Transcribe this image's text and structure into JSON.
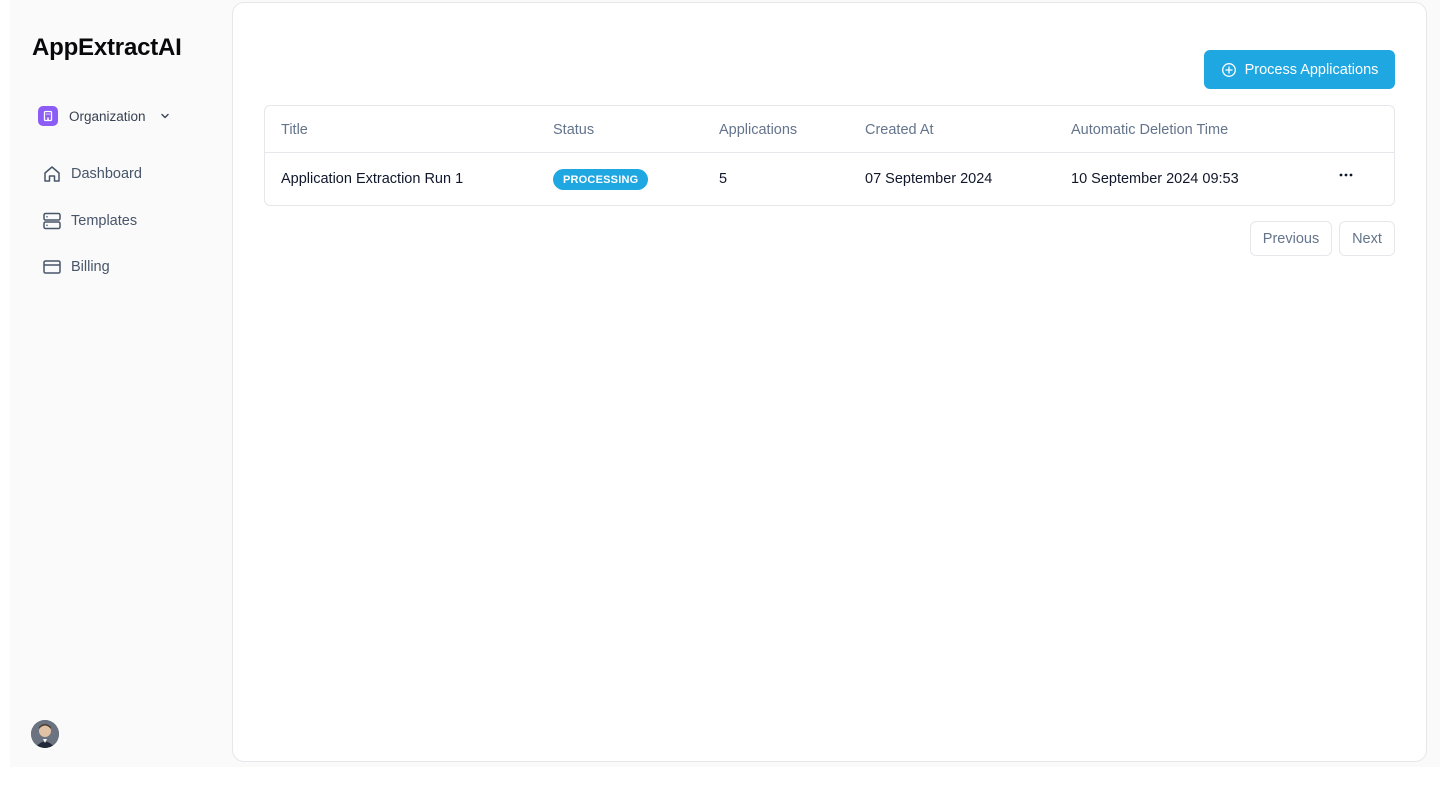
{
  "app": {
    "brand": "AppExtractAI"
  },
  "sidebar": {
    "organization": "Organization",
    "items": [
      {
        "label": "Dashboard",
        "icon": "home-icon"
      },
      {
        "label": "Templates",
        "icon": "server-icon"
      },
      {
        "label": "Billing",
        "icon": "credit-card-icon"
      }
    ]
  },
  "toolbar": {
    "process_label": "Process Applications",
    "process_icon": "plus-circle-icon"
  },
  "table": {
    "columns": [
      "Title",
      "Status",
      "Applications",
      "Created At",
      "Automatic Deletion Time"
    ],
    "rows": [
      {
        "title": "Application Extraction Run 1",
        "status": "PROCESSING",
        "applications": "5",
        "created_at": "07 September 2024",
        "deletion_time": "10 September 2024 09:53"
      }
    ]
  },
  "pagination": {
    "previous": "Previous",
    "next": "Next"
  },
  "colors": {
    "accent": "#1ea7e1",
    "org_badge": "#8b5cf6"
  }
}
